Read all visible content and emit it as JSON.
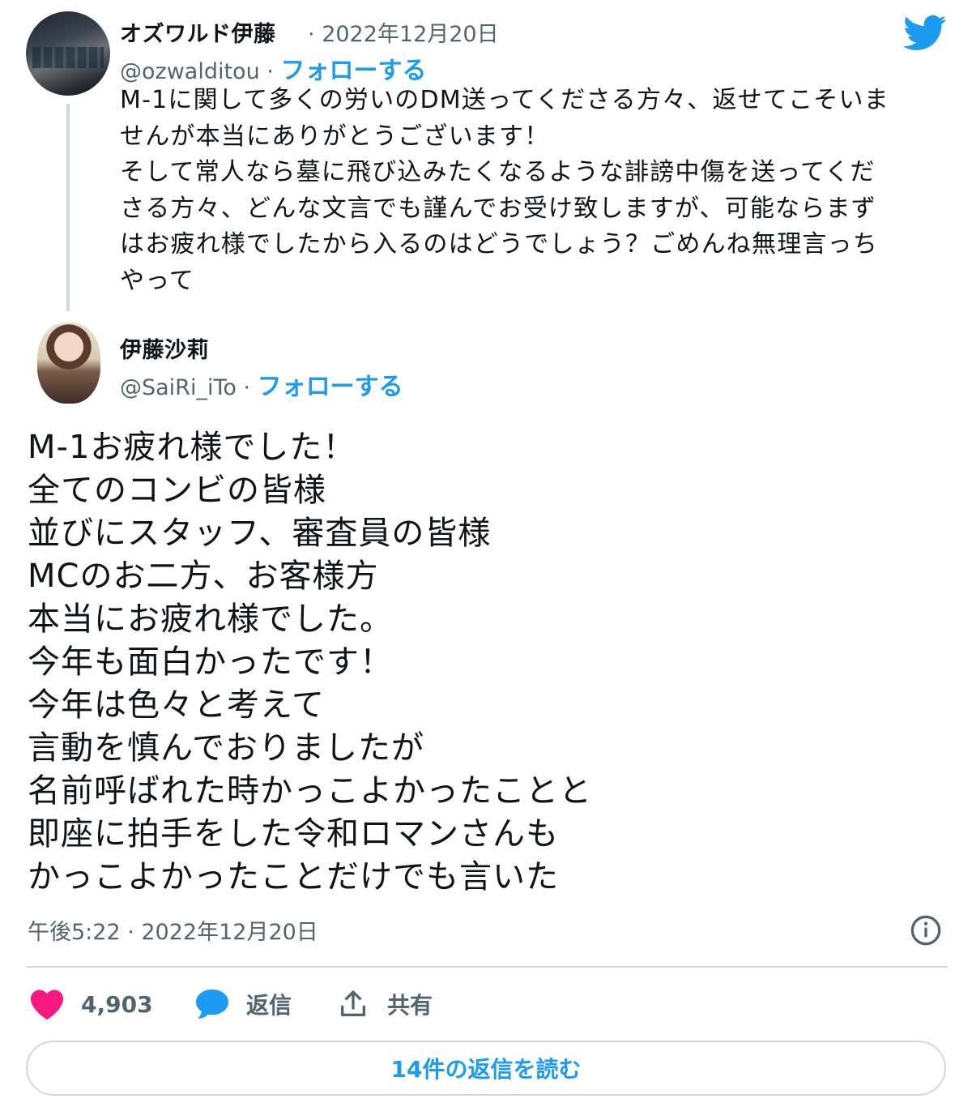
{
  "quoted_tweet": {
    "author_name": "オズワルド伊藤",
    "date": "2022年12月20日",
    "handle": "@ozwalditou",
    "follow_label": "フォローする",
    "text": "M-1に関して多くの労いのDM送ってくださる方々、返せてこそいま\nせんが本当にありがとうございます！\nそして常人なら墓に飛び込みたくなるような誹謗中傷を送ってくだ\nさる方々、どんな文言でも謹んでお受け致しますが、可能ならまず\nはお疲れ様でしたから入るのはどうでしょう？ごめんね無理言っち\nやって"
  },
  "reply_tweet": {
    "author_name": "伊藤沙莉",
    "handle": "@SaiRi_iTo",
    "follow_label": "フォローする",
    "text": "M-1お疲れ様でした！\n全てのコンビの皆様\n並びにスタッフ、審査員の皆様\nMCのお二方、お客様方\n本当にお疲れ様でした。\n今年も面白かったです！\n今年は色々と考えて\n言動を慎んでおりましたが\n名前呼ばれた時かっこよかったことと\n即座に拍手をした令和ロマンさんも\nかっこよかったことだけでも言いた",
    "timestamp": "午後5:22 · 2022年12月20日"
  },
  "actions": {
    "like_count": "4,903",
    "reply_label": "返信",
    "share_label": "共有"
  },
  "read_replies_label": "14件の返信を読む",
  "separator": "·",
  "icons": {
    "brand": "twitter-bird-icon",
    "info": "info-icon",
    "like": "heart-icon",
    "reply": "speech-bubble-icon",
    "share": "share-upload-icon"
  },
  "colors": {
    "accent": "#1d9bf0",
    "like": "#f91880",
    "muted": "#536471",
    "border": "#cfd9de"
  }
}
